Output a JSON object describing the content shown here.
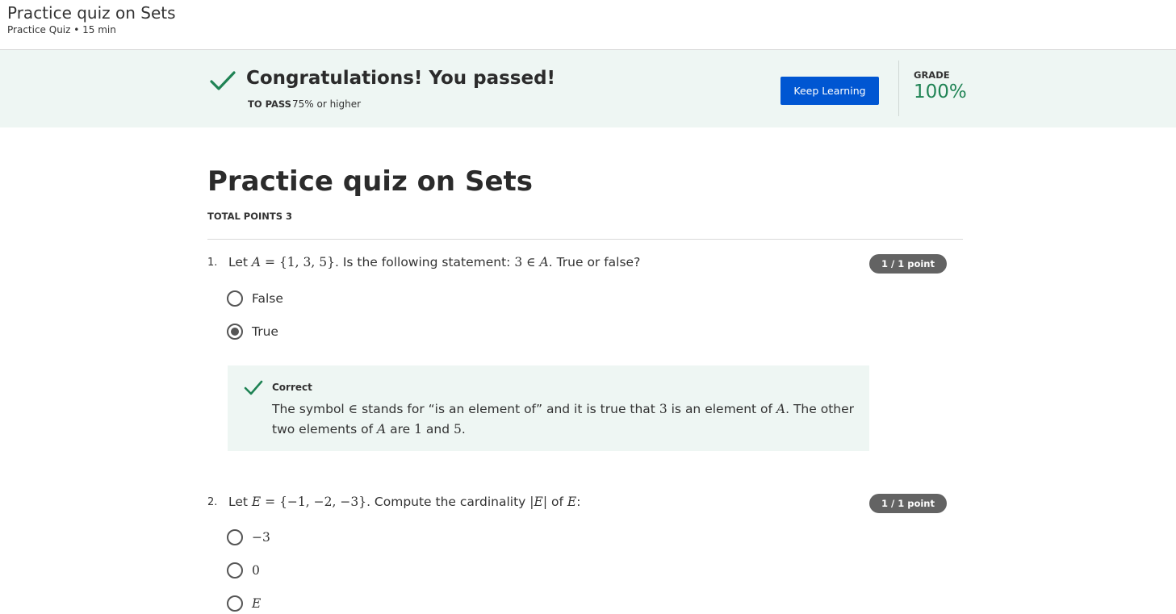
{
  "header": {
    "title": "Practice quiz on Sets",
    "subtitle": "Practice Quiz • 15 min"
  },
  "result": {
    "message": "Congratulations! You passed!",
    "to_pass_label": "TO PASS",
    "to_pass_value": "75% or higher",
    "keep_learning_label": "Keep Learning",
    "grade_label": "GRADE",
    "grade_value": "100%"
  },
  "quiz": {
    "title": "Practice quiz on Sets",
    "total_points": "TOTAL POINTS 3",
    "questions": [
      {
        "number": "1.",
        "points": "1 / 1 point",
        "text": {
          "prefix": "Let ",
          "set_name": "A",
          "definition": " = {1, 3, 5}",
          "middle": ". Is the following statement: ",
          "statement_num": "3 ∈ ",
          "statement_set": "A",
          "suffix": ". True or false?"
        },
        "options": [
          {
            "label": "False",
            "selected": false
          },
          {
            "label": "True",
            "selected": true
          }
        ],
        "feedback": {
          "title": "Correct",
          "t1": "The symbol ",
          "sym": "∈",
          "t2": " stands for “is an element of” and it is true that ",
          "n3": "3",
          "t3": " is an element of ",
          "setA1": "A",
          "t4": ". The other two elements of ",
          "setA2": "A",
          "t5": " are ",
          "n1": "1",
          "t6": " and ",
          "n5": "5",
          "t7": "."
        }
      },
      {
        "number": "2.",
        "points": "1 / 1 point",
        "text": {
          "prefix": "Let ",
          "set_name": "E",
          "definition": " = {−1, −2, −3}",
          "middle": ". Compute the cardinality ",
          "card_open": "|",
          "card_set": "E",
          "card_close": "|",
          "of": " of ",
          "set_again": "E",
          "suffix": ":"
        },
        "options": [
          {
            "label": "−3",
            "selected": false
          },
          {
            "label": "0",
            "selected": false
          },
          {
            "label": "E",
            "selected": false
          }
        ]
      }
    ]
  },
  "colors": {
    "banner_bg": "#eef6f3",
    "success_green": "#1f8354",
    "primary_blue": "#0056d2",
    "pill_gray": "#636363"
  }
}
